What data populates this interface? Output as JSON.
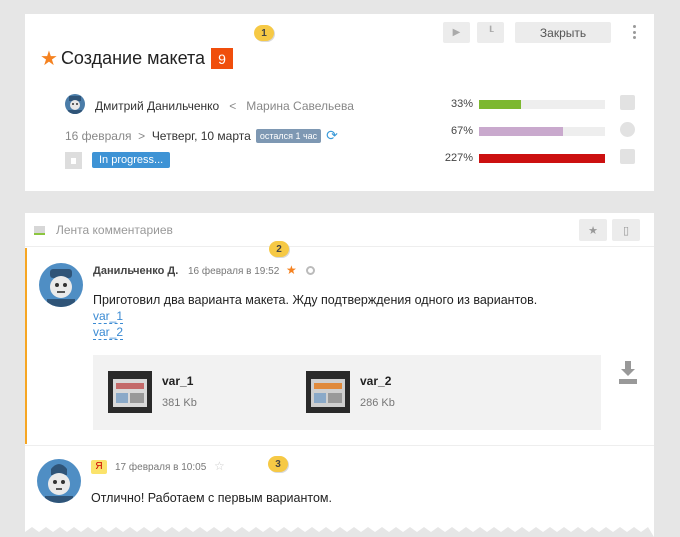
{
  "task": {
    "toolbar": {
      "play_icon": "play-icon",
      "step_icon": "step-icon",
      "close_label": "Закрыть"
    },
    "title": "Создание макета",
    "count": "9",
    "callout_1": "1",
    "responsible": "Дмитрий Данильченко",
    "arrow": "<",
    "creator": "Марина Савельева",
    "start_date": "16 февраля",
    "date_arrow": ">",
    "end_date": "Четверг, 10 марта",
    "remain_badge": "остался 1 час",
    "status": "In progress...",
    "metrics": [
      {
        "label": "33%",
        "value": 33,
        "color": "#7cb82f",
        "icon": "check-icon"
      },
      {
        "label": "67%",
        "value": 67,
        "color": "#c9a9cd",
        "icon": "clock-icon"
      },
      {
        "label": "227%",
        "value": 227,
        "color": "#cc1010",
        "icon": "dollar-icon"
      }
    ]
  },
  "feed": {
    "title": "Лента комментариев",
    "comments": [
      {
        "author": "Данильченко Д.",
        "date": "16 февраля в 19:52",
        "callout": "2",
        "text": "Приготовил два варианта макета. Жду подтверждения одного из вариантов.",
        "links": [
          "var_1",
          "var_2"
        ],
        "files": [
          {
            "name": "var_1",
            "size": "381 Kb"
          },
          {
            "name": "var_2",
            "size": "286 Kb"
          }
        ]
      },
      {
        "badge": "Я",
        "date": "17 февраля в 10:05",
        "callout": "3",
        "text": "Отлично! Работаем с первым вариантом."
      }
    ]
  },
  "colors": {
    "accent_orange": "#f58220",
    "badge_red": "#f04e0c",
    "status_blue": "#3e93d5",
    "link_blue": "#3a8ad3"
  }
}
